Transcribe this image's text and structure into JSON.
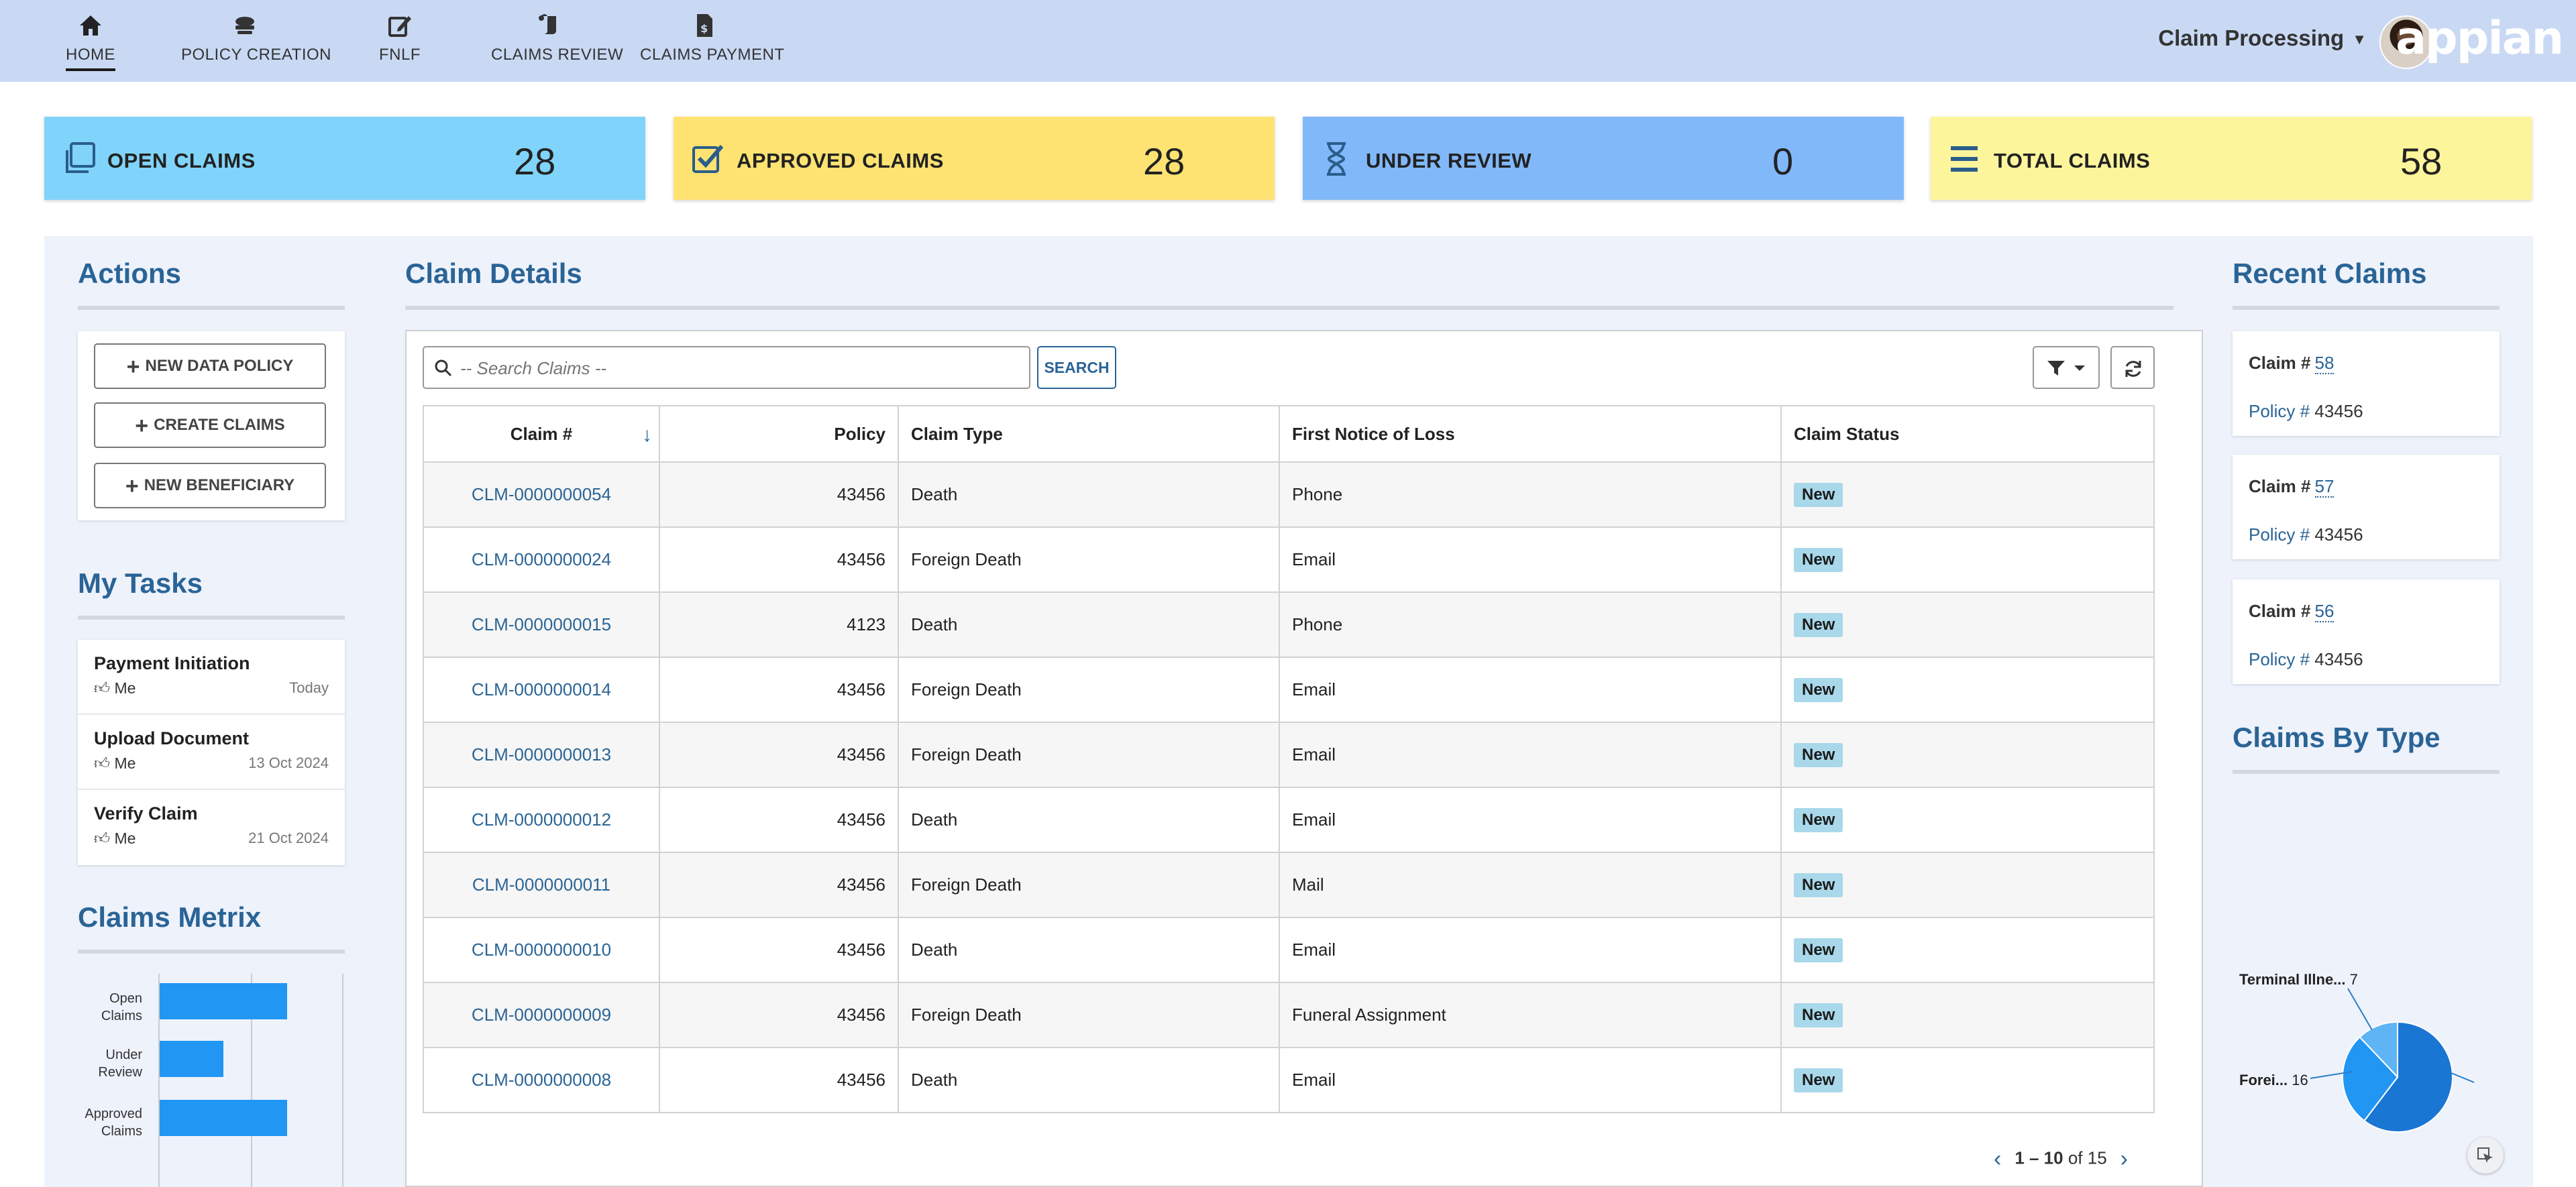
{
  "nav": {
    "items": [
      {
        "label": "HOME",
        "icon": "home-icon"
      },
      {
        "label": "POLICY CREATION",
        "icon": "policy-icon"
      },
      {
        "label": "FNLF",
        "icon": "edit-icon"
      },
      {
        "label": "CLAIMS REVIEW",
        "icon": "scroll-icon"
      },
      {
        "label": "CLAIMS PAYMENT",
        "icon": "invoice-icon"
      }
    ],
    "workspace": "Claim Processing",
    "logo": "appian"
  },
  "kpis": [
    {
      "label": "OPEN CLAIMS",
      "value": "28",
      "icon": "copy-icon",
      "color": "#80d4fb"
    },
    {
      "label": "APPROVED CLAIMS",
      "value": "28",
      "icon": "checkbox-icon",
      "color": "#fee372"
    },
    {
      "label": "UNDER REVIEW",
      "value": "0",
      "icon": "hourglass-icon",
      "color": "#81b8fa"
    },
    {
      "label": "TOTAL CLAIMS",
      "value": "58",
      "icon": "list-icon",
      "color": "#fdf59c"
    }
  ],
  "actions": {
    "title": "Actions",
    "buttons": [
      "NEW DATA POLICY",
      "CREATE CLAIMS",
      "NEW BENEFICIARY"
    ]
  },
  "tasks": {
    "title": "My Tasks",
    "items": [
      {
        "name": "Payment Initiation",
        "assignee": "Me",
        "date": "Today"
      },
      {
        "name": "Upload Document",
        "assignee": "Me",
        "date": "13 Oct 2024"
      },
      {
        "name": "Verify Claim",
        "assignee": "Me",
        "date": "21 Oct 2024"
      }
    ]
  },
  "metrix": {
    "title": "Claims Metrix",
    "bars": [
      {
        "label_1": "Open",
        "label_2": "Claims",
        "value": 28
      },
      {
        "label_1": "Under",
        "label_2": "Review",
        "value": 14
      },
      {
        "label_1": "Approved",
        "label_2": "Claims",
        "value": 28
      }
    ],
    "xmax": 40
  },
  "claims": {
    "title": "Claim Details",
    "search_placeholder": "-- Search Claims --",
    "search_label": "SEARCH",
    "columns": [
      "Claim #",
      "Policy",
      "Claim Type",
      "First Notice of Loss",
      "Claim Status"
    ],
    "rows": [
      {
        "claim": "CLM-0000000054",
        "policy": "43456",
        "type": "Death",
        "fnol": "Phone",
        "status": "New"
      },
      {
        "claim": "CLM-0000000024",
        "policy": "43456",
        "type": "Foreign Death",
        "fnol": "Email",
        "status": "New"
      },
      {
        "claim": "CLM-0000000015",
        "policy": "4123",
        "type": "Death",
        "fnol": "Phone",
        "status": "New"
      },
      {
        "claim": "CLM-0000000014",
        "policy": "43456",
        "type": "Foreign Death",
        "fnol": "Email",
        "status": "New"
      },
      {
        "claim": "CLM-0000000013",
        "policy": "43456",
        "type": "Foreign Death",
        "fnol": "Email",
        "status": "New"
      },
      {
        "claim": "CLM-0000000012",
        "policy": "43456",
        "type": "Death",
        "fnol": "Email",
        "status": "New"
      },
      {
        "claim": "CLM-0000000011",
        "policy": "43456",
        "type": "Foreign Death",
        "fnol": "Mail",
        "status": "New"
      },
      {
        "claim": "CLM-0000000010",
        "policy": "43456",
        "type": "Death",
        "fnol": "Email",
        "status": "New"
      },
      {
        "claim": "CLM-0000000009",
        "policy": "43456",
        "type": "Foreign Death",
        "fnol": "Funeral Assignment",
        "status": "New"
      },
      {
        "claim": "CLM-0000000008",
        "policy": "43456",
        "type": "Death",
        "fnol": "Email",
        "status": "New"
      }
    ],
    "pager_range": "1 – 10",
    "pager_of": "of 15"
  },
  "recent": {
    "title": "Recent Claims",
    "claim_label": "Claim #",
    "policy_label": "Policy #",
    "items": [
      {
        "claim": "58",
        "policy": "43456"
      },
      {
        "claim": "57",
        "policy": "43456"
      },
      {
        "claim": "56",
        "policy": "43456"
      }
    ]
  },
  "bytype": {
    "title": "Claims By Type",
    "slices": [
      {
        "label": "Terminal Illne...",
        "value": 7,
        "color": "#5fb4f6"
      },
      {
        "label": "Forei...",
        "value": 16,
        "color": "#2196f3"
      },
      {
        "label": "",
        "value": 35,
        "color": "#1976d2"
      }
    ]
  }
}
